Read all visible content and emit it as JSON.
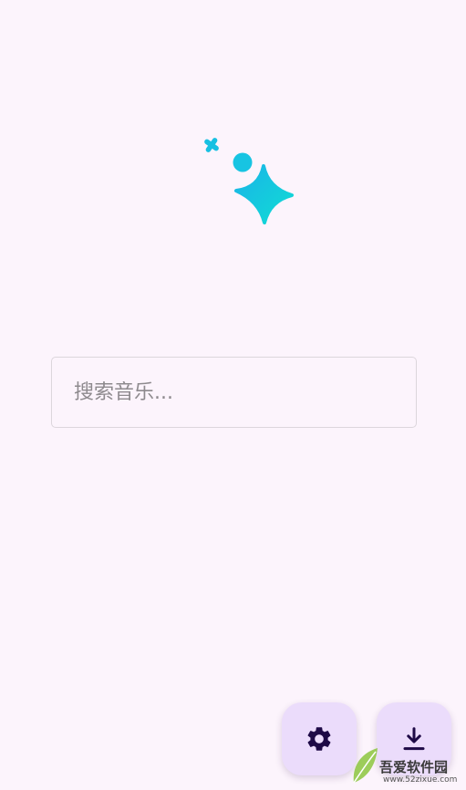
{
  "search": {
    "placeholder": "搜索音乐..."
  },
  "icons": {
    "hero": "sparkle-icon",
    "settings": "gear-icon",
    "download": "download-icon"
  },
  "colors": {
    "background": "#fcf4fc",
    "accent": "#14c8e0",
    "fab_background": "#ebdcfb",
    "fab_icon": "#1e0a46"
  },
  "watermark": {
    "title": "吾爱软件园",
    "url": "www.52zixue.com"
  }
}
